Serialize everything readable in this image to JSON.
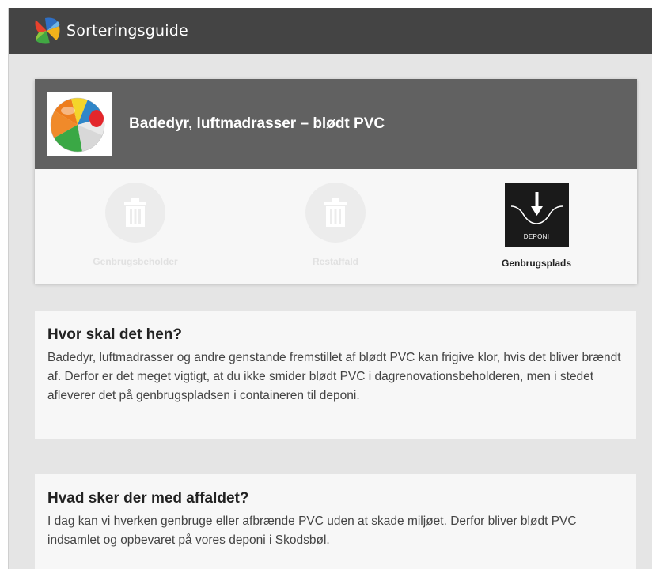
{
  "header": {
    "app_title": "Sorteringsguide",
    "logo_icon": "colorful-pinwheel-logo"
  },
  "item": {
    "title": "Badedyr, luftmadrasser – blødt PVC",
    "image_icon": "beach-ball-icon"
  },
  "options": [
    {
      "label": "Genbrugsbeholder",
      "icon": "trash-can-icon",
      "active": false
    },
    {
      "label": "Restaffald",
      "icon": "trash-can-icon",
      "active": false
    },
    {
      "label": "Genbrugsplads",
      "icon": "deponi-icon",
      "icon_text": "DEPONI",
      "active": true
    }
  ],
  "sections": [
    {
      "heading": "Hvor skal det hen?",
      "body": "Badedyr, luftmadrasser og andre genstande fremstillet af blødt PVC kan frigive klor, hvis det bliver brændt af. Derfor er det meget vigtigt, at du ikke smider blødt PVC i dagrenovationsbeholderen, men i stedet afleverer det på genbrugspladsen i containeren til deponi."
    },
    {
      "heading": "Hvad sker der med affaldet?",
      "body": "I dag kan vi hverken genbruge eller afbrænde PVC uden at skade miljøet. Derfor bliver blødt PVC indsamlet og opbevaret på vores deponi i Skodsbøl."
    }
  ],
  "colors": {
    "topbar": "#444444",
    "card_header": "#616161",
    "page_background": "#e5e5e5",
    "card_background": "#f7f7f7"
  }
}
